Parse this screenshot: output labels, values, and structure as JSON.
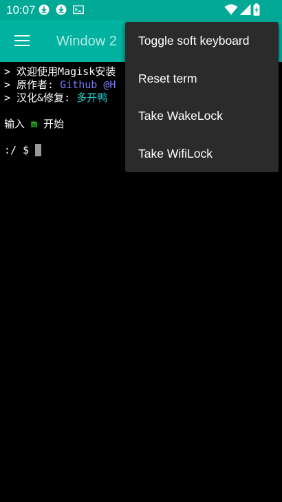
{
  "status_bar": {
    "time": "10:07",
    "left_icons": [
      "download-icon",
      "download-icon",
      "terminal-icon"
    ],
    "right_icons": [
      "wifi-icon",
      "signal-icon",
      "battery-charging-icon"
    ],
    "color": "#00a896"
  },
  "app_bar": {
    "title": "Window 2",
    "color": "#00b29f"
  },
  "terminal": {
    "line1_prefix": "> 欢迎使用Magisk安装",
    "line2_prefix": "> 原作者: ",
    "line2_highlight": "Github @H",
    "line3_prefix": "> 汉化&修复: ",
    "line3_highlight": "多开鸭",
    "line4_before": "输入 ",
    "line4_key": "m",
    "line4_after": " 开始",
    "prompt": ":/ $ "
  },
  "menu": {
    "items": [
      {
        "label": "Toggle soft keyboard"
      },
      {
        "label": "Reset term"
      },
      {
        "label": "Take WakeLock"
      },
      {
        "label": "Take WifiLock"
      }
    ]
  }
}
